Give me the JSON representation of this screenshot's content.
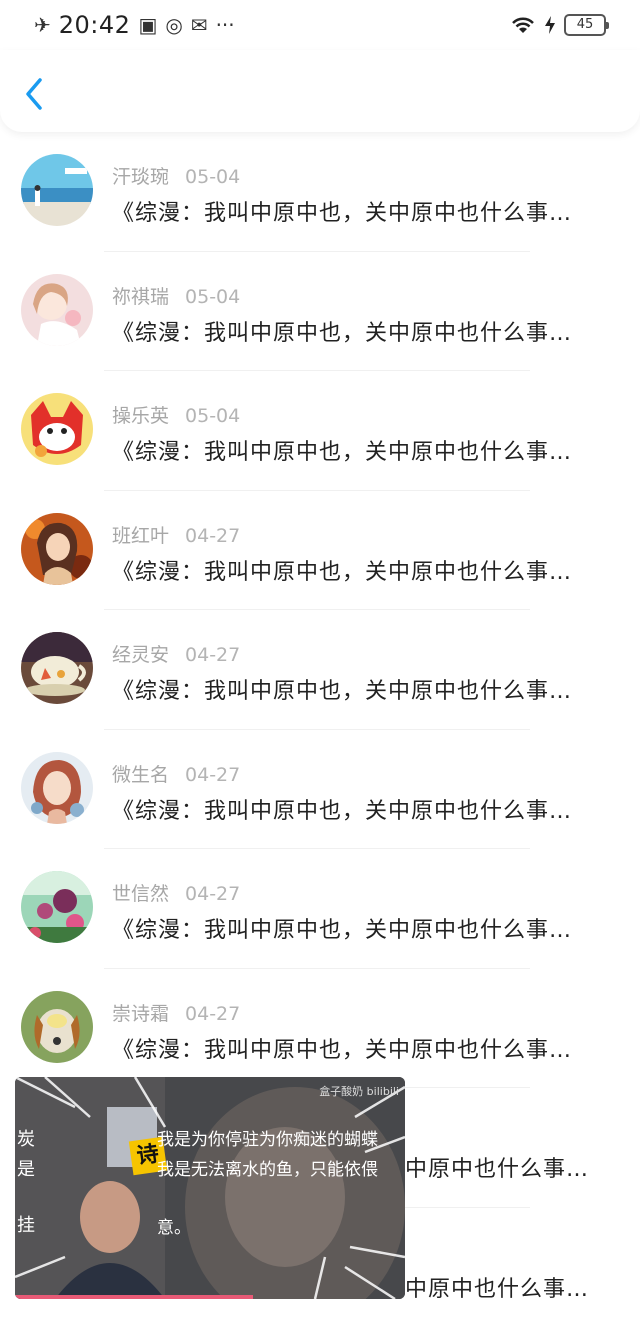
{
  "status_bar": {
    "time": "20:42",
    "battery": "45",
    "icons": [
      "airplane-icon",
      "sim-icon",
      "sync-icon",
      "notification-icon",
      "more-icon",
      "wifi-icon",
      "charging-icon",
      "battery-icon"
    ]
  },
  "nav": {
    "back_icon": "chevron-left-icon"
  },
  "accent_color": "#1a9bf0",
  "messages": [
    {
      "name": "汗琰琬",
      "date": "05-04",
      "text": "《综漫：我叫中原中也，关中原中也什么事…"
    },
    {
      "name": "祢祺瑞",
      "date": "05-04",
      "text": "《综漫：我叫中原中也，关中原中也什么事…"
    },
    {
      "name": "操乐英",
      "date": "05-04",
      "text": "《综漫：我叫中原中也，关中原中也什么事…"
    },
    {
      "name": "班红叶",
      "date": "04-27",
      "text": "《综漫：我叫中原中也，关中原中也什么事…"
    },
    {
      "name": "经灵安",
      "date": "04-27",
      "text": "《综漫：我叫中原中也，关中原中也什么事…"
    },
    {
      "name": "微生名",
      "date": "04-27",
      "text": "《综漫：我叫中原中也，关中原中也什么事…"
    },
    {
      "name": "世信然",
      "date": "04-27",
      "text": "《综漫：我叫中原中也，关中原中也什么事…"
    },
    {
      "name": "崇诗霜",
      "date": "04-27",
      "text": "《综漫：我叫中原中也，关中原中也什么事…"
    },
    {
      "name": "",
      "date": "",
      "text": "中原中也什么事…"
    },
    {
      "name": "",
      "date": "",
      "text": "中原中也什么事…"
    }
  ],
  "video": {
    "watermark": "盒子酸奶 bilibili",
    "caption_1": "我是为你停驻为你痴迷的蝴蝶",
    "caption_2": "我是无法离水的鱼，只能依偎",
    "caption_3": "意。",
    "left_fragment_1": "炭",
    "left_fragment_2": "是",
    "left_fragment_3": "挂",
    "badge": "诗",
    "progress": 0.61
  }
}
